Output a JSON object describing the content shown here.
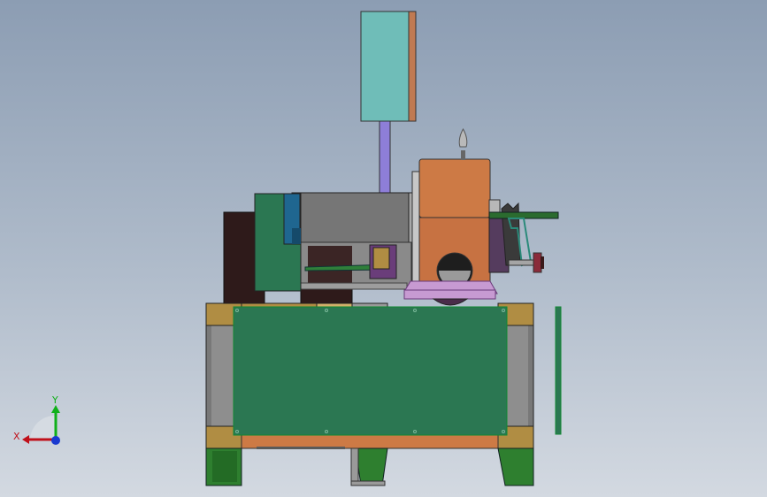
{
  "triad": {
    "x_label": "X",
    "y_label": "Y",
    "colors": {
      "x": "#c0101a",
      "y": "#10b01a",
      "z": "#1a3ad0"
    }
  },
  "model": {
    "colors": {
      "frame_green": "#2b7752",
      "frame_gray": "#787878",
      "corner_gold": "#b08d43",
      "copper": "#cd7a45",
      "cyan_box": "#6fbdb8",
      "dark_brown": "#2e1a1a",
      "steel_blue": "#2a6ea0",
      "violet": "#c79ad2"
    }
  }
}
